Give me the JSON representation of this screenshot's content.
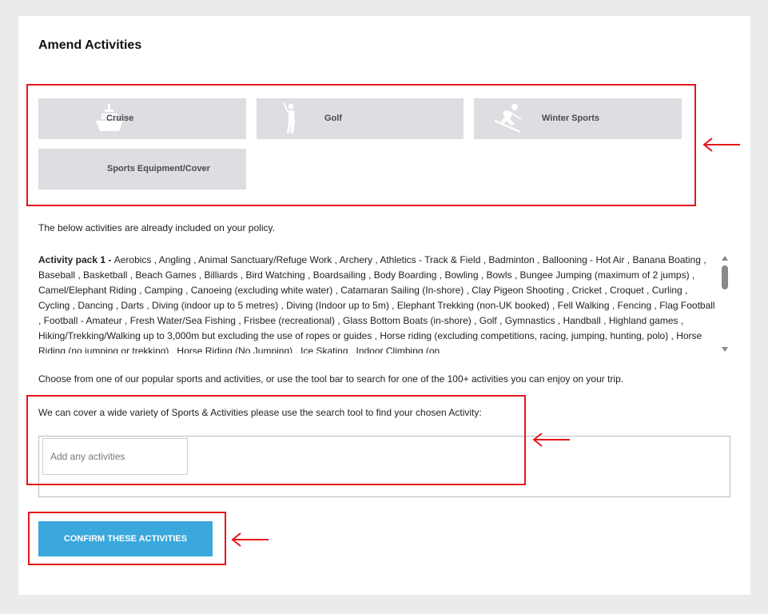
{
  "page": {
    "title": "Amend Activities"
  },
  "tiles": [
    {
      "label": "Cruise",
      "icon": "ship-icon"
    },
    {
      "label": "Golf",
      "icon": "golfer-icon"
    },
    {
      "label": "Winter Sports",
      "icon": "skier-icon"
    },
    {
      "label": "Sports Equipment/Cover",
      "icon": ""
    }
  ],
  "included": {
    "intro": "The below activities are already included on your policy.",
    "pack_label": "Activity pack 1 - ",
    "pack_text": "Aerobics , Angling , Animal Sanctuary/Refuge Work , Archery , Athletics - Track & Field , Badminton , Ballooning - Hot Air , Banana Boating , Baseball , Basketball , Beach Games , Billiards , Bird Watching , Boardsailing , Body Boarding , Bowling , Bowls , Bungee Jumping (maximum of 2 jumps) , Camel/Elephant Riding , Camping , Canoeing (excluding white water) , Catamaran Sailing (In-shore) , Clay Pigeon Shooting , Cricket , Croquet , Curling , Cycling , Dancing , Darts , Diving (indoor up to 5 metres) , Diving (Indoor up to 5m) , Elephant Trekking (non-UK booked) , Fell Walking , Fencing , Flag Football , Football - Amateur , Fresh Water/Sea Fishing , Frisbee (recreational) , Glass Bottom Boats (in-shore) , Golf , Gymnastics , Handball , Highland games , Hiking/Trekking/Walking up to 3,000m but excluding the use of ropes or guides , Horse riding (excluding competitions, racing, jumping, hunting, polo) , Horse Riding (no jumping or trekking) , Horse Riding (No Jumping) , Ice Skating , Indoor Climbing (on"
  },
  "choose_text": "Choose from one of our popular sports and activities, or use the tool bar to search for one of the 100+ activities you can enjoy on your trip.",
  "search": {
    "intro": "We can cover a wide variety of Sports & Activities please use the search tool to find your chosen Activity:",
    "placeholder": "Add any activities"
  },
  "confirm_label": "CONFIRM THESE ACTIVITIES",
  "colors": {
    "accent": "#3aa8dc",
    "highlight": "#e5161b",
    "tile": "#dedde2"
  }
}
